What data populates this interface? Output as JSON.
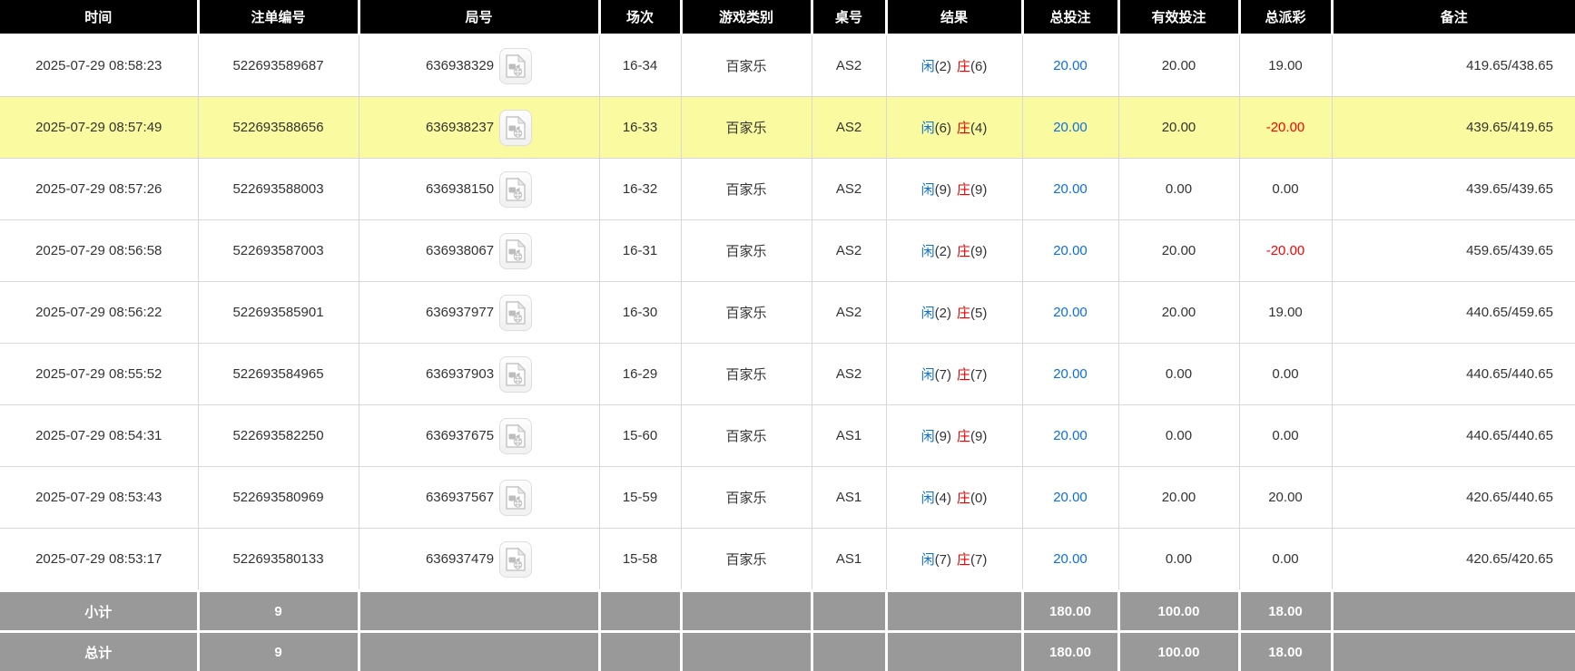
{
  "table": {
    "columns": [
      {
        "key": "time",
        "label": "时间"
      },
      {
        "key": "bet_id",
        "label": "注单编号"
      },
      {
        "key": "round_id",
        "label": "局号"
      },
      {
        "key": "session",
        "label": "场次"
      },
      {
        "key": "game_type",
        "label": "游戏类别"
      },
      {
        "key": "table_no",
        "label": "桌号"
      },
      {
        "key": "result",
        "label": "结果"
      },
      {
        "key": "total_bet",
        "label": "总投注"
      },
      {
        "key": "valid_bet",
        "label": "有效投注"
      },
      {
        "key": "total_payout",
        "label": "总派彩"
      },
      {
        "key": "remark",
        "label": "备注"
      }
    ],
    "rows": [
      {
        "time": "2025-07-29 08:58:23",
        "bet_id": "522693589687",
        "round_id": "636938329",
        "session": "16-34",
        "game_type": "百家乐",
        "table_no": "AS2",
        "result": {
          "player_label": "闲",
          "player_value": "(2)",
          "banker_label": "庄",
          "banker_value": "(6)"
        },
        "total_bet": "20.00",
        "valid_bet": "20.00",
        "total_payout": "19.00",
        "remark": "419.65/438.65"
      },
      {
        "time": "2025-07-29 08:57:49",
        "bet_id": "522693588656",
        "round_id": "636938237",
        "session": "16-33",
        "game_type": "百家乐",
        "table_no": "AS2",
        "result": {
          "player_label": "闲",
          "player_value": "(6)",
          "banker_label": "庄",
          "banker_value": "(4)"
        },
        "total_bet": "20.00",
        "valid_bet": "20.00",
        "total_payout": "-20.00",
        "remark": "439.65/419.65"
      },
      {
        "time": "2025-07-29 08:57:26",
        "bet_id": "522693588003",
        "round_id": "636938150",
        "session": "16-32",
        "game_type": "百家乐",
        "table_no": "AS2",
        "result": {
          "player_label": "闲",
          "player_value": "(9)",
          "banker_label": "庄",
          "banker_value": "(9)"
        },
        "total_bet": "20.00",
        "valid_bet": "0.00",
        "total_payout": "0.00",
        "remark": "439.65/439.65"
      },
      {
        "time": "2025-07-29 08:56:58",
        "bet_id": "522693587003",
        "round_id": "636938067",
        "session": "16-31",
        "game_type": "百家乐",
        "table_no": "AS2",
        "result": {
          "player_label": "闲",
          "player_value": "(2)",
          "banker_label": "庄",
          "banker_value": "(9)"
        },
        "total_bet": "20.00",
        "valid_bet": "20.00",
        "total_payout": "-20.00",
        "remark": "459.65/439.65"
      },
      {
        "time": "2025-07-29 08:56:22",
        "bet_id": "522693585901",
        "round_id": "636937977",
        "session": "16-30",
        "game_type": "百家乐",
        "table_no": "AS2",
        "result": {
          "player_label": "闲",
          "player_value": "(2)",
          "banker_label": "庄",
          "banker_value": "(5)"
        },
        "total_bet": "20.00",
        "valid_bet": "20.00",
        "total_payout": "19.00",
        "remark": "440.65/459.65"
      },
      {
        "time": "2025-07-29 08:55:52",
        "bet_id": "522693584965",
        "round_id": "636937903",
        "session": "16-29",
        "game_type": "百家乐",
        "table_no": "AS2",
        "result": {
          "player_label": "闲",
          "player_value": "(7)",
          "banker_label": "庄",
          "banker_value": "(7)"
        },
        "total_bet": "20.00",
        "valid_bet": "0.00",
        "total_payout": "0.00",
        "remark": "440.65/440.65"
      },
      {
        "time": "2025-07-29 08:54:31",
        "bet_id": "522693582250",
        "round_id": "636937675",
        "session": "15-60",
        "game_type": "百家乐",
        "table_no": "AS1",
        "result": {
          "player_label": "闲",
          "player_value": "(9)",
          "banker_label": "庄",
          "banker_value": "(9)"
        },
        "total_bet": "20.00",
        "valid_bet": "0.00",
        "total_payout": "0.00",
        "remark": "440.65/440.65"
      },
      {
        "time": "2025-07-29 08:53:43",
        "bet_id": "522693580969",
        "round_id": "636937567",
        "session": "15-59",
        "game_type": "百家乐",
        "table_no": "AS1",
        "result": {
          "player_label": "闲",
          "player_value": "(4)",
          "banker_label": "庄",
          "banker_value": "(0)"
        },
        "total_bet": "20.00",
        "valid_bet": "20.00",
        "total_payout": "20.00",
        "remark": "420.65/440.65"
      },
      {
        "time": "2025-07-29 08:53:17",
        "bet_id": "522693580133",
        "round_id": "636937479",
        "session": "15-58",
        "game_type": "百家乐",
        "table_no": "AS1",
        "result": {
          "player_label": "闲",
          "player_value": "(7)",
          "banker_label": "庄",
          "banker_value": "(7)"
        },
        "total_bet": "20.00",
        "valid_bet": "0.00",
        "total_payout": "0.00",
        "remark": "420.65/420.65"
      }
    ],
    "summary": {
      "subtotal": {
        "label": "小计",
        "count": "9",
        "total_bet": "180.00",
        "valid_bet": "100.00",
        "total_payout": "18.00"
      },
      "grand_total": {
        "label": "总计",
        "count": "9",
        "total_bet": "180.00",
        "valid_bet": "100.00",
        "total_payout": "18.00"
      }
    }
  },
  "icons": {
    "round_video": "video-file-icon"
  },
  "colors": {
    "header_bg": "#000000",
    "header_text": "#ffffff",
    "footer_bg": "#999999",
    "footer_text": "#ffffff",
    "highlight_row": "#fafaa0",
    "player_blue": "#0d6fe0",
    "banker_red": "#e80000",
    "bet_amount_blue": "#0d6fe0",
    "negative_payout_red": "#ff0000",
    "grid_line": "#d8d8d8"
  }
}
